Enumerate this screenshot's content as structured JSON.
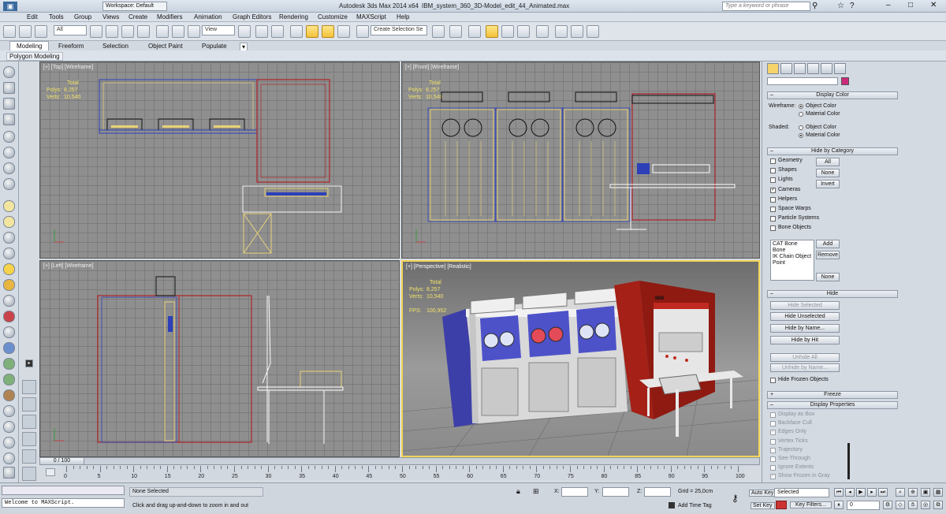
{
  "title_bar": {
    "app": "Autodesk 3ds Max  2014 x64",
    "file": "IBM_system_360_3D-Model_edit_44_Animated.max",
    "workspace": "Workspace: Default",
    "search_placeholder": "Type a keyword or phrase"
  },
  "menu": [
    "Edit",
    "Tools",
    "Group",
    "Views",
    "Create",
    "Modifiers",
    "Animation",
    "Graph Editors",
    "Rendering",
    "Customize",
    "MAXScript",
    "Help"
  ],
  "toolbar": {
    "filter": "All",
    "refcoord": "View",
    "selection_set": "Create Selection Se"
  },
  "ribbon": {
    "tabs": [
      "Modeling",
      "Freeform",
      "Selection",
      "Object Paint",
      "Populate"
    ],
    "active": "Modeling",
    "subtab": "Polygon Modeling"
  },
  "viewports": {
    "top": {
      "label": "[+] [Top] [Wireframe]",
      "total": "Total",
      "polys_k": "Polys:",
      "polys": "8,257",
      "verts_k": "Verts:",
      "verts": "10,540"
    },
    "front": {
      "label": "[+] [Front] [Wireframe]",
      "total": "Total",
      "polys_k": "Polys:",
      "polys": "8,257",
      "verts_k": "Verts:",
      "verts": "10,540"
    },
    "left": {
      "label": "[+] [Left] [Wireframe]"
    },
    "persp": {
      "label": "[+] [Perspective] [Realistic]",
      "total": "Total",
      "polys_k": "Polys:",
      "polys": "8,257",
      "verts_k": "Verts:",
      "verts": "10,540",
      "fps_k": "FPS:",
      "fps": "100,952",
      "brand1": "IBM"
    }
  },
  "command_panel": {
    "display_color": {
      "title": "Display Color",
      "wire_label": "Wireframe:",
      "wire_opt1": "Object Color",
      "wire_opt2": "Material Color",
      "shaded_label": "Shaded:",
      "shaded_opt1": "Object Color",
      "shaded_opt2": "Material Color"
    },
    "hide_by_category": {
      "title": "Hide by Category",
      "items": [
        "Geometry",
        "Shapes",
        "Lights",
        "Cameras",
        "Helpers",
        "Space Warps",
        "Particle Systems",
        "Bone Objects"
      ],
      "checked": [
        false,
        false,
        false,
        true,
        false,
        false,
        false,
        false
      ],
      "btn_all": "All",
      "btn_none": "None",
      "btn_invert": "Invert",
      "list": [
        "CAT Bone",
        "Bone",
        "IK Chain Object",
        "Point"
      ],
      "btn_add": "Add",
      "btn_remove": "Remove",
      "btn_none2": "None"
    },
    "hide": {
      "title": "Hide",
      "buttons": [
        "Hide Selected",
        "Hide Unselected",
        "Hide by Name...",
        "Hide by Hit"
      ],
      "unhide": [
        "Unhide All",
        "Unhide by Name..."
      ],
      "frozen": "Hide Frozen Objects"
    },
    "freeze": {
      "title": "Freeze"
    },
    "display_properties": {
      "title": "Display Properties",
      "items": [
        "Display as Box",
        "Backface Cull",
        "Edges Only",
        "Vertex Ticks",
        "Trajectory",
        "See-Through",
        "Ignore Extents",
        "Show Frozen in Gray"
      ],
      "checked": [
        false,
        false,
        true,
        false,
        false,
        false,
        false,
        true
      ]
    }
  },
  "timeline": {
    "frame_counter": "0 / 100",
    "ticks": [
      "0",
      "5",
      "10",
      "15",
      "20",
      "25",
      "30",
      "35",
      "40",
      "45",
      "50",
      "55",
      "60",
      "65",
      "70",
      "75",
      "80",
      "85",
      "90",
      "95",
      "100"
    ]
  },
  "status": {
    "maxscript": "Welcome to MAXScript.",
    "selection": "None Selected",
    "prompt": "Click and drag up-and-down to zoom in and out",
    "x_label": "X:",
    "y_label": "Y:",
    "z_label": "Z:",
    "grid": "Grid = 25,0cm",
    "add_time_tag": "Add Time Tag",
    "auto_key": "Auto Key",
    "set_key": "Set Key",
    "selected": "Selected",
    "key_filters": "Key Filters...",
    "frame": "0"
  },
  "colors": {
    "accent": "#f2d55a",
    "viewport_bg": "#8f8f8f",
    "wire_red": "#b0242a",
    "wire_yellow": "#e8d27a",
    "wire_blue": "#2d40b8"
  }
}
